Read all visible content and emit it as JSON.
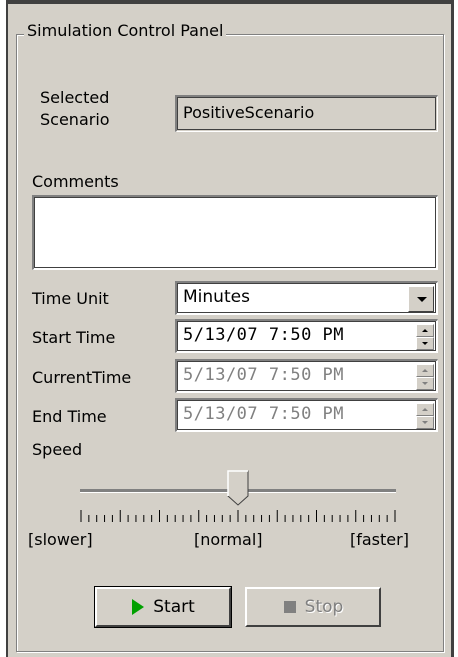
{
  "panel": {
    "title": "Simulation Control Panel"
  },
  "scenario": {
    "label_line1": "Selected",
    "label_line2": "Scenario",
    "value": "PositiveScenario"
  },
  "comments": {
    "label": "Comments",
    "value": ""
  },
  "time_unit": {
    "label": "Time Unit",
    "value": "Minutes"
  },
  "start_time": {
    "label": "Start Time",
    "value": "5/13/07 7:50 PM"
  },
  "current_time": {
    "label": "CurrentTime",
    "value": "5/13/07 7:50 PM"
  },
  "end_time": {
    "label": "End Time",
    "value": "5/13/07 7:50 PM"
  },
  "speed": {
    "label": "Speed",
    "slower_label": "[slower]",
    "normal_label": "[normal]",
    "faster_label": "[faster]",
    "value_fraction": 0.5
  },
  "buttons": {
    "start_label": "Start",
    "stop_label": "Stop"
  },
  "colors": {
    "start_icon": "#00a000",
    "stop_icon": "#808080"
  },
  "icons": {
    "start": "play-icon",
    "stop": "stop-icon"
  }
}
